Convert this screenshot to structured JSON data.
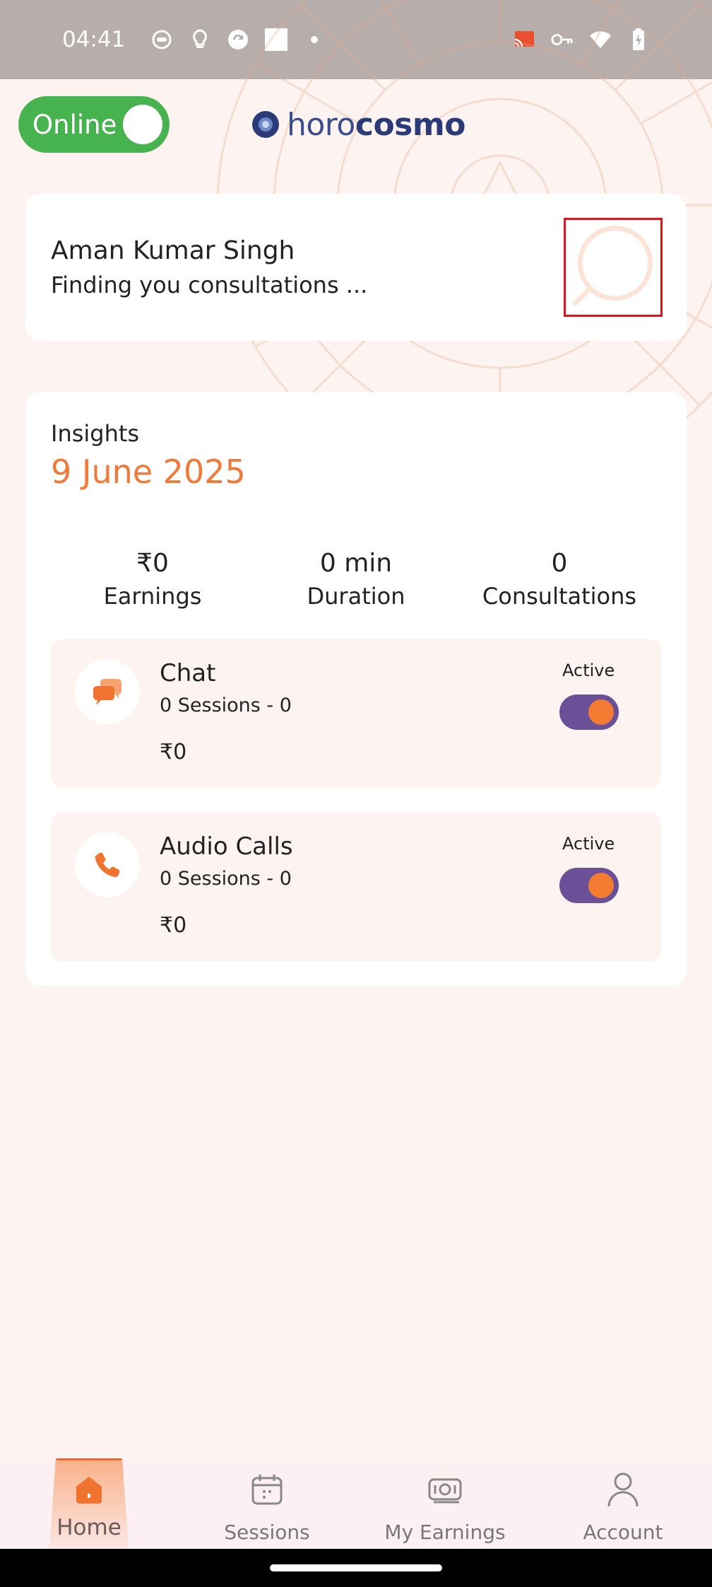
{
  "status_bar": {
    "time": "04:41",
    "left_icons": [
      "face-icon",
      "bulb-icon",
      "sync-icon",
      "square-icon",
      "dot-icon"
    ],
    "right_icons": [
      "cast-icon",
      "key-icon",
      "wifi-icon",
      "battery-icon"
    ]
  },
  "header": {
    "online_label": "Online",
    "online_on": true,
    "brand_prefix": "horo",
    "brand_suffix": "cosmo"
  },
  "profile": {
    "name": "Aman Kumar Singh",
    "status": "Finding you consultations ..."
  },
  "insights": {
    "label": "Insights",
    "date": "9 June 2025",
    "stats": [
      {
        "value": "₹0",
        "label": "Earnings"
      },
      {
        "value": "0 min",
        "label": "Duration"
      },
      {
        "value": "0",
        "label": "Consultations"
      }
    ],
    "services": [
      {
        "title": "Chat",
        "sessions": "0 Sessions - 0",
        "amount": "₹0",
        "status_label": "Active",
        "enabled": true,
        "icon": "chat-icon"
      },
      {
        "title": "Audio Calls",
        "sessions": "0 Sessions - 0",
        "amount": "₹0",
        "status_label": "Active",
        "enabled": true,
        "icon": "phone-icon"
      }
    ]
  },
  "bottom_nav": {
    "items": [
      {
        "label": "Home",
        "icon": "home-icon",
        "active": true
      },
      {
        "label": "Sessions",
        "icon": "calendar-icon",
        "active": false
      },
      {
        "label": "My Earnings",
        "icon": "money-icon",
        "active": false
      },
      {
        "label": "Account",
        "icon": "person-icon",
        "active": false
      }
    ]
  },
  "colors": {
    "accent": "#f07a3a",
    "online_green": "#47b34f",
    "switch_track": "#6b4f97",
    "brand_blue": "#3a4e8d"
  }
}
